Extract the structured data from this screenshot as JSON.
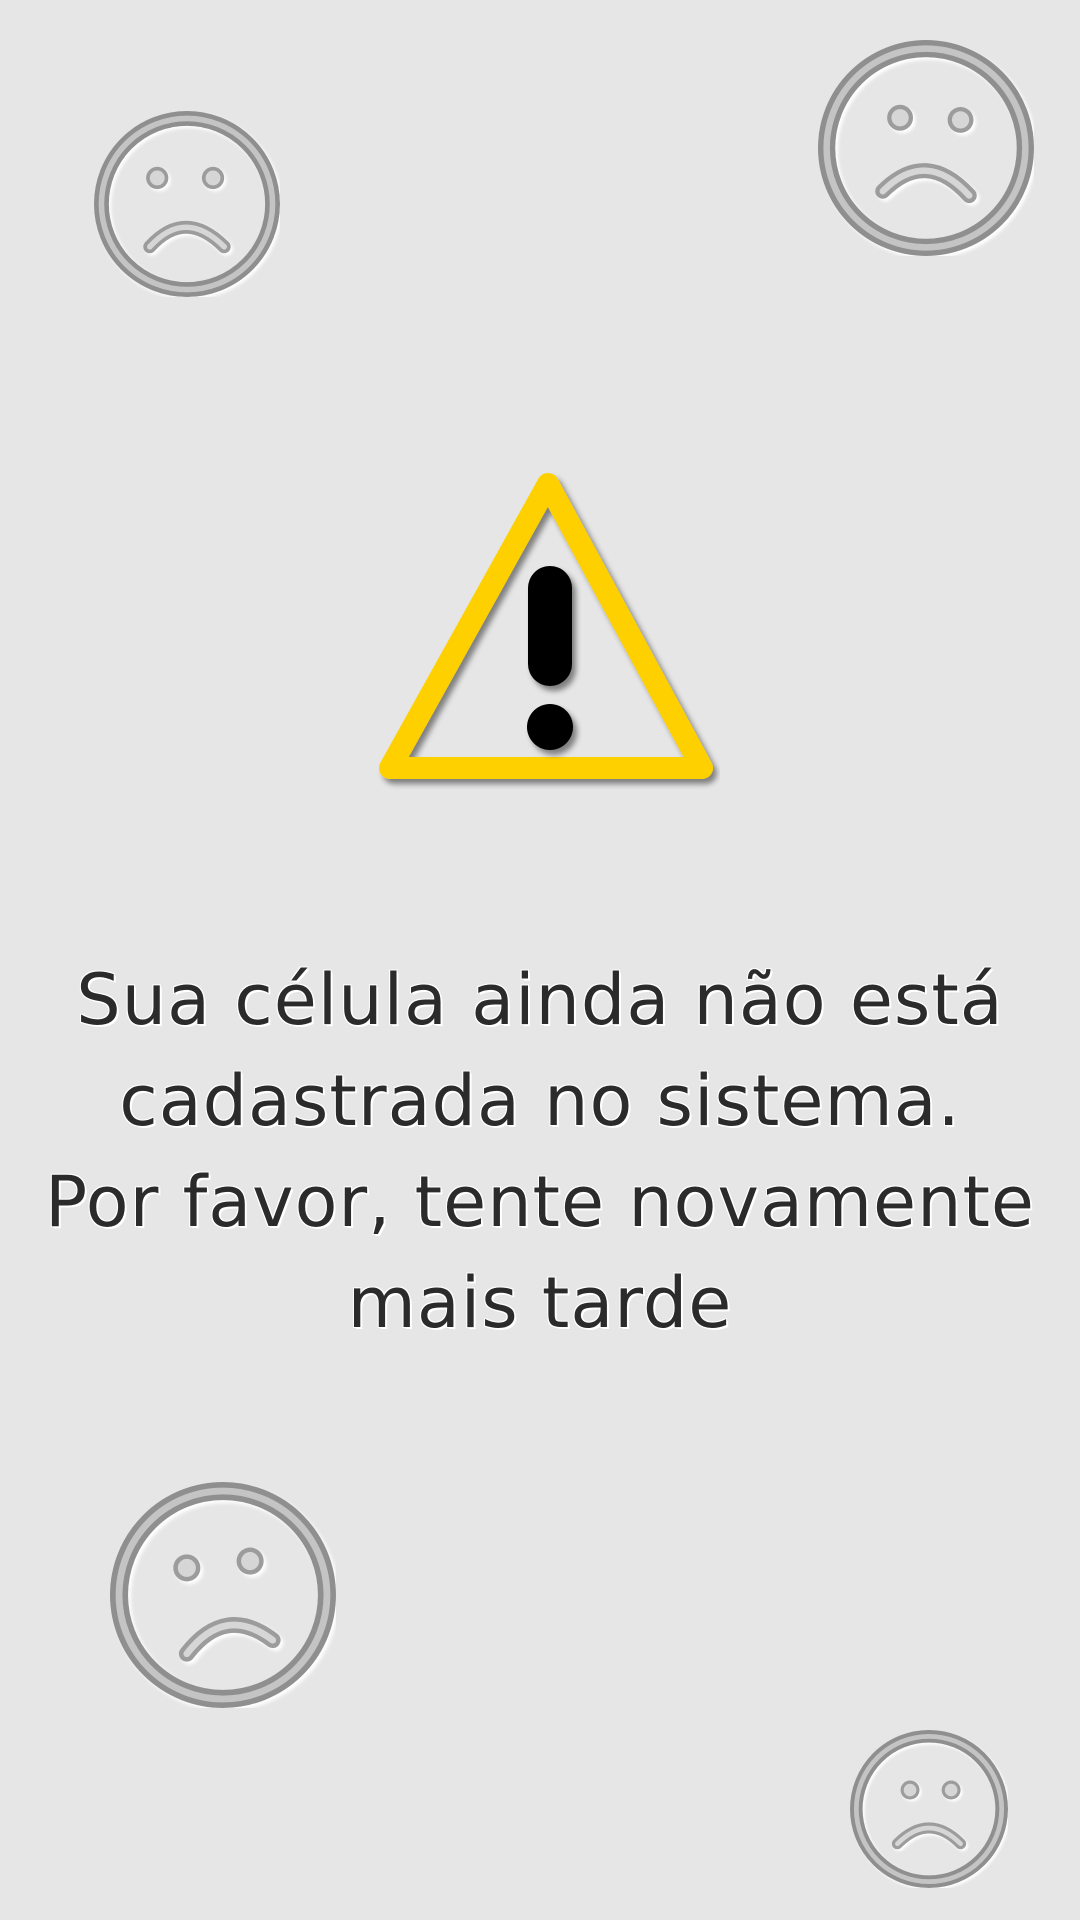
{
  "screen": {
    "background_color": "#e6e6e6",
    "accent_color": "#ffd000",
    "text_color": "#2b2b2b"
  },
  "icons": {
    "warning": "warning-triangle-icon",
    "faces": [
      "sad-face-icon",
      "sad-face-icon",
      "sad-face-icon",
      "sad-face-icon"
    ]
  },
  "message": {
    "lines": [
      "Sua célula ainda não está",
      "cadastrada no sistema.",
      "Por favor, tente novamente",
      "mais tarde"
    ]
  }
}
